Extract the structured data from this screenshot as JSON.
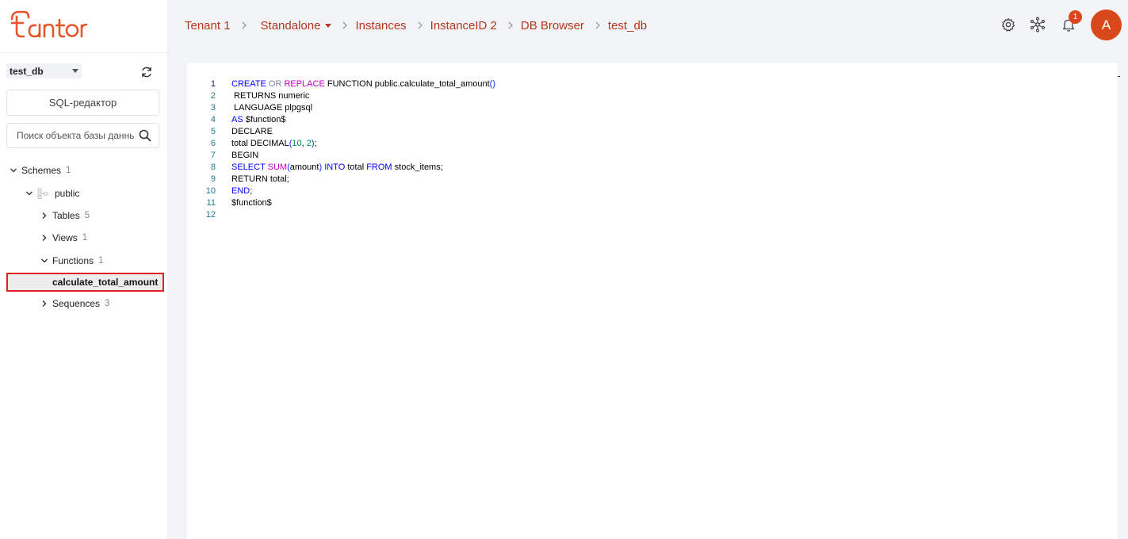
{
  "brand": {
    "name": "tantor",
    "color": "#e8542a"
  },
  "colors": {
    "accent": "#b5361a",
    "badge": "#d9481a",
    "selection_border": "#e31b23"
  },
  "sidebar": {
    "database_select": {
      "value": "test_db"
    },
    "sql_editor_label": "SQL-редактор",
    "search": {
      "placeholder": "Поиск объекта базы данных"
    },
    "tree": {
      "schemes": {
        "label": "Schemes",
        "count": "1"
      },
      "public": {
        "label": "public"
      },
      "tables": {
        "label": "Tables",
        "count": "5"
      },
      "views": {
        "label": "Views",
        "count": "1"
      },
      "functions": {
        "label": "Functions",
        "count": "1"
      },
      "selected_function": {
        "label": "calculate_total_amount"
      },
      "sequences": {
        "label": "Sequences",
        "count": "3"
      }
    }
  },
  "breadcrumbs": {
    "tenant": "Tenant 1",
    "mode": "Standalone",
    "instances": "Instances",
    "instance": "InstanceID 2",
    "db_browser": "DB Browser",
    "database": "test_db"
  },
  "header": {
    "icons": [
      "gear-icon",
      "cluster-icon",
      "bell-icon"
    ],
    "notification_count": "1",
    "avatar_initial": "A"
  },
  "editor": {
    "lines": [
      {
        "n": "1",
        "tokens": [
          [
            "kw",
            "CREATE"
          ],
          [
            "t",
            " "
          ],
          [
            "op",
            "OR"
          ],
          [
            "t",
            " "
          ],
          [
            "fn",
            "REPLACE"
          ],
          [
            "t",
            " FUNCTION public.calculate_total_amount"
          ],
          [
            "pn",
            "()"
          ]
        ]
      },
      {
        "n": "2",
        "tokens": [
          [
            "t",
            " RETURNS numeric"
          ]
        ]
      },
      {
        "n": "3",
        "tokens": [
          [
            "t",
            " LANGUAGE plpgsql"
          ]
        ]
      },
      {
        "n": "4",
        "tokens": [
          [
            "kw",
            "AS"
          ],
          [
            "t",
            " $function$"
          ]
        ]
      },
      {
        "n": "5",
        "tokens": [
          [
            "t",
            "DECLARE"
          ]
        ]
      },
      {
        "n": "6",
        "tokens": [
          [
            "t",
            "total DECIMAL"
          ],
          [
            "pn",
            "("
          ],
          [
            "num",
            "10"
          ],
          [
            "t",
            ", "
          ],
          [
            "num",
            "2"
          ],
          [
            "pn",
            ")"
          ],
          [
            "t",
            ";"
          ]
        ]
      },
      {
        "n": "7",
        "tokens": [
          [
            "t",
            "BEGIN"
          ]
        ]
      },
      {
        "n": "8",
        "tokens": [
          [
            "kw",
            "SELECT"
          ],
          [
            "t",
            " "
          ],
          [
            "fn",
            "SUM"
          ],
          [
            "pn",
            "("
          ],
          [
            "t",
            "amount"
          ],
          [
            "pn",
            ")"
          ],
          [
            "t",
            " "
          ],
          [
            "kw",
            "INTO"
          ],
          [
            "t",
            " total "
          ],
          [
            "kw",
            "FROM"
          ],
          [
            "t",
            " stock_items;"
          ]
        ]
      },
      {
        "n": "9",
        "tokens": [
          [
            "t",
            "RETURN total;"
          ]
        ]
      },
      {
        "n": "10",
        "tokens": [
          [
            "kw",
            "END"
          ],
          [
            "t",
            ";"
          ]
        ]
      },
      {
        "n": "11",
        "tokens": [
          [
            "t",
            "$function$"
          ]
        ]
      },
      {
        "n": "12",
        "tokens": []
      }
    ]
  }
}
